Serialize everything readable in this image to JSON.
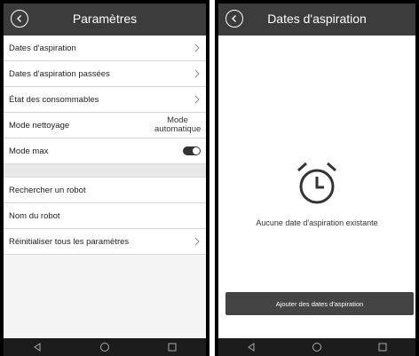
{
  "left_screen": {
    "title": "Paramètres",
    "rows": [
      {
        "label": "Dates d'aspiration",
        "chevron": true
      },
      {
        "label": "Dates d'aspiration passées",
        "chevron": true
      },
      {
        "label": "État des consommables",
        "chevron": true
      },
      {
        "label": "Mode nettoyage",
        "value_line1": "Mode",
        "value_line2": "automatique"
      },
      {
        "label": "Mode max",
        "toggle_on": true
      }
    ],
    "rows2": [
      {
        "label": "Rechercher un robot"
      },
      {
        "label": "Nom du  robot"
      },
      {
        "label": "Réinitialiser tous les paramètres",
        "chevron": true
      }
    ]
  },
  "right_screen": {
    "title": "Dates d'aspiration",
    "empty_message": "Aucune date d'aspiration existante",
    "add_button": "Ajouter des dates d'aspiration"
  },
  "icons": {
    "back": "back-circle-icon",
    "chevron": "chevron-right-icon",
    "alarm": "alarm-clock-icon",
    "nav_back": "triangle-back-icon",
    "nav_home": "circle-home-icon",
    "nav_recent": "square-recent-icon"
  },
  "colors": {
    "appbar": "#3c3c3c",
    "navbar": "#1c1c1c",
    "button": "#444444"
  }
}
